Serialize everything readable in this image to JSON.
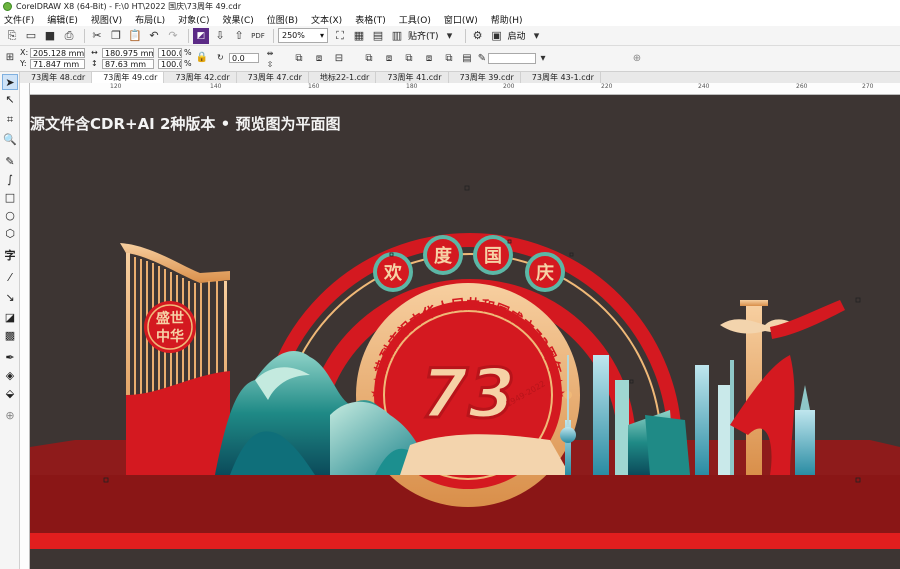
{
  "window": {
    "title": "CorelDRAW X8 (64-Bit) - F:\\0 HT\\2022 国庆\\73周年 49.cdr"
  },
  "menu": [
    "文件(F)",
    "编辑(E)",
    "视图(V)",
    "布局(L)",
    "对象(C)",
    "效果(C)",
    "位图(B)",
    "文本(X)",
    "表格(T)",
    "工具(O)",
    "窗口(W)",
    "帮助(H)"
  ],
  "toolbar": {
    "zoom": "250%",
    "snap_label": "贴齐(T)",
    "launch_label": "启动"
  },
  "property_bar": {
    "x_label": "X:",
    "x_value": "205.128 mm",
    "y_label": "Y:",
    "y_value": "71.847 mm",
    "w_value": "180.975 mm",
    "h_value": "87.63 mm",
    "scale_w": "100.0",
    "scale_h": "100.0",
    "percent": "%",
    "rotation": "0.0"
  },
  "tabs": [
    "73周年 48.cdr",
    "73周年 49.cdr",
    "73周年 42.cdr",
    "73周年 47.cdr",
    "地标22-1.cdr",
    "73周年 41.cdr",
    "73周年 39.cdr",
    "73周年 43-1.cdr"
  ],
  "active_tab_index": 1,
  "ruler_h": [
    "120",
    "140",
    "160",
    "180",
    "200",
    "220",
    "240",
    "260",
    "270"
  ],
  "canvas": {
    "watermark": "源文件含CDR+AI 2种版本 • 预览图为平面图",
    "banner_chars": [
      "欢",
      "度",
      "国",
      "庆"
    ],
    "arc_text": "★热烈庆祝中华人民共和国成立73周年★",
    "big_number": "73",
    "small_number": "1949-2022",
    "gate_line1": "盛世",
    "gate_line2": "中华"
  },
  "colors": {
    "canvas_bg": "#3d3533",
    "red": "#d41920",
    "dark_red": "#8e1b1b",
    "gold": "#f0b978",
    "teal": "#1f8a86"
  }
}
